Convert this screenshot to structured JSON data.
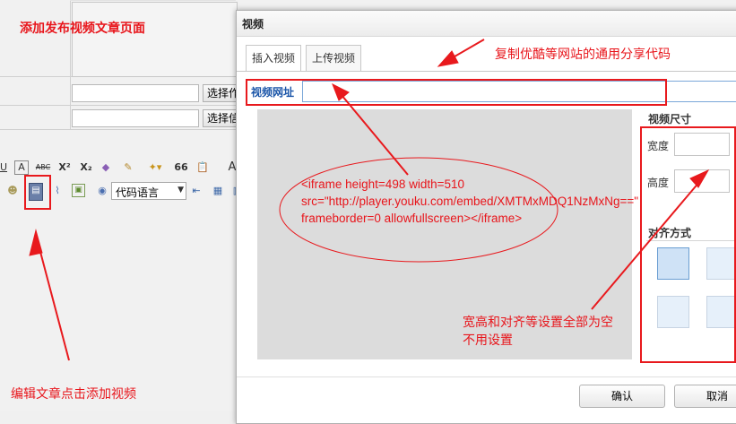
{
  "page": {
    "heading": "添加发布视频文章页面",
    "browse_button_1": "选择作",
    "browse_button_2": "选择信",
    "code_lang_select": "代码语言",
    "caption_bottom": "编辑文章点击添加视频"
  },
  "toolbar": {
    "icons": [
      "underline-icon",
      "font-color-icon",
      "strikethrough-icon",
      "superscript-icon",
      "subscript-icon",
      "eraser-icon",
      "format-brush-icon",
      "magic-wand-icon",
      "quote-icon",
      "paste-icon",
      "font-icon",
      "emoticon-icon",
      "video-icon",
      "attachment-icon",
      "image-icon",
      "map-icon",
      "table-icon",
      "insert-col-icon",
      "insert-frame-icon"
    ],
    "superscript_label": "X²",
    "subscript_label": "X₂",
    "quote_label": "66",
    "font_label": "A",
    "strike_label": "ABC"
  },
  "dialog": {
    "title": "视频",
    "tabs": [
      "插入视频",
      "上传视频"
    ],
    "url_label": "视频网址",
    "url_value": "",
    "size_heading": "视频尺寸",
    "width_label": "宽度",
    "height_label": "高度",
    "align_heading": "对齐方式",
    "confirm": "确认",
    "cancel": "取消"
  },
  "annotations": {
    "top_note": "复制优酷等网站的通用分享代码",
    "iframe_code_line1": "<iframe height=498 width=510",
    "iframe_code_line2": "src=\"http://player.youku.com/embed/XMTMxMDQ1NzMxNg==\"",
    "iframe_code_line3": "frameborder=0 allowfullscreen></iframe>",
    "size_note_line1": "宽高和对齐等设置全部为空",
    "size_note_line2": "不用设置"
  },
  "colors": {
    "annotation_red": "#e8151b",
    "url_label_blue": "#1a55a8"
  }
}
